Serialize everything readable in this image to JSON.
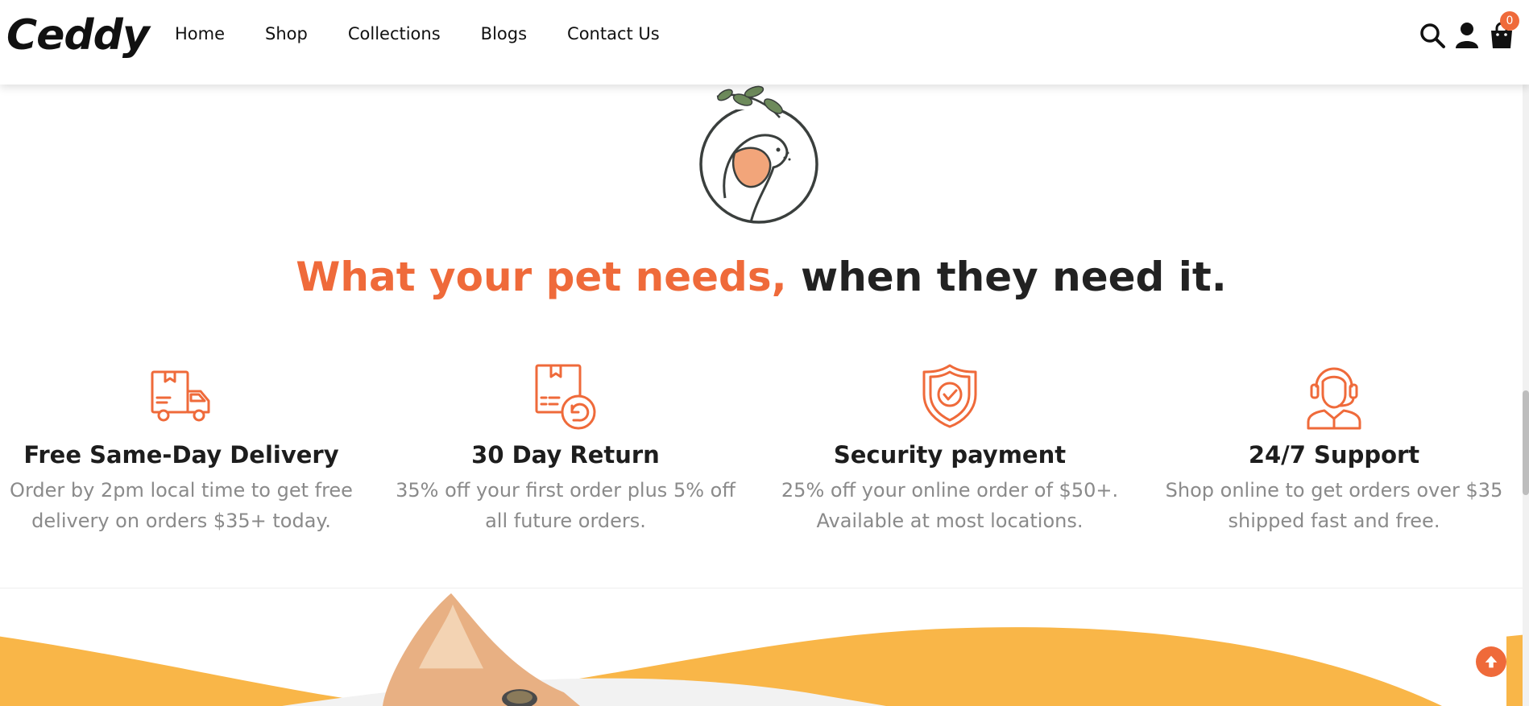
{
  "header": {
    "logo": "Ceddy",
    "nav": [
      {
        "label": "Home"
      },
      {
        "label": "Shop"
      },
      {
        "label": "Collections"
      },
      {
        "label": "Blogs"
      },
      {
        "label": "Contact Us"
      }
    ],
    "icons": [
      "search-icon",
      "user-icon",
      "cart-icon"
    ],
    "cart_count": "0"
  },
  "hero": {
    "headline_accent": "What your pet needs,",
    "headline_rest": " when they need it."
  },
  "features": [
    {
      "icon": "delivery-truck-icon",
      "title": "Free Same-Day Delivery",
      "text": "Order by 2pm local time to get free delivery on orders $35+ today."
    },
    {
      "icon": "return-box-icon",
      "title": "30 Day Return",
      "text": "35% off your first order plus 5% off all future orders."
    },
    {
      "icon": "security-shield-icon",
      "title": "Security payment",
      "text": "25% off your online order of $50+. Available at most locations."
    },
    {
      "icon": "support-headset-icon",
      "title": "24/7 Support",
      "text": "Shop online to get orders over $35 shipped fast and free."
    }
  ],
  "colors": {
    "accent": "#ef6a3a",
    "banner_yellow": "#f9b648",
    "text_dark": "#222222",
    "text_muted": "#8a8a8a"
  }
}
